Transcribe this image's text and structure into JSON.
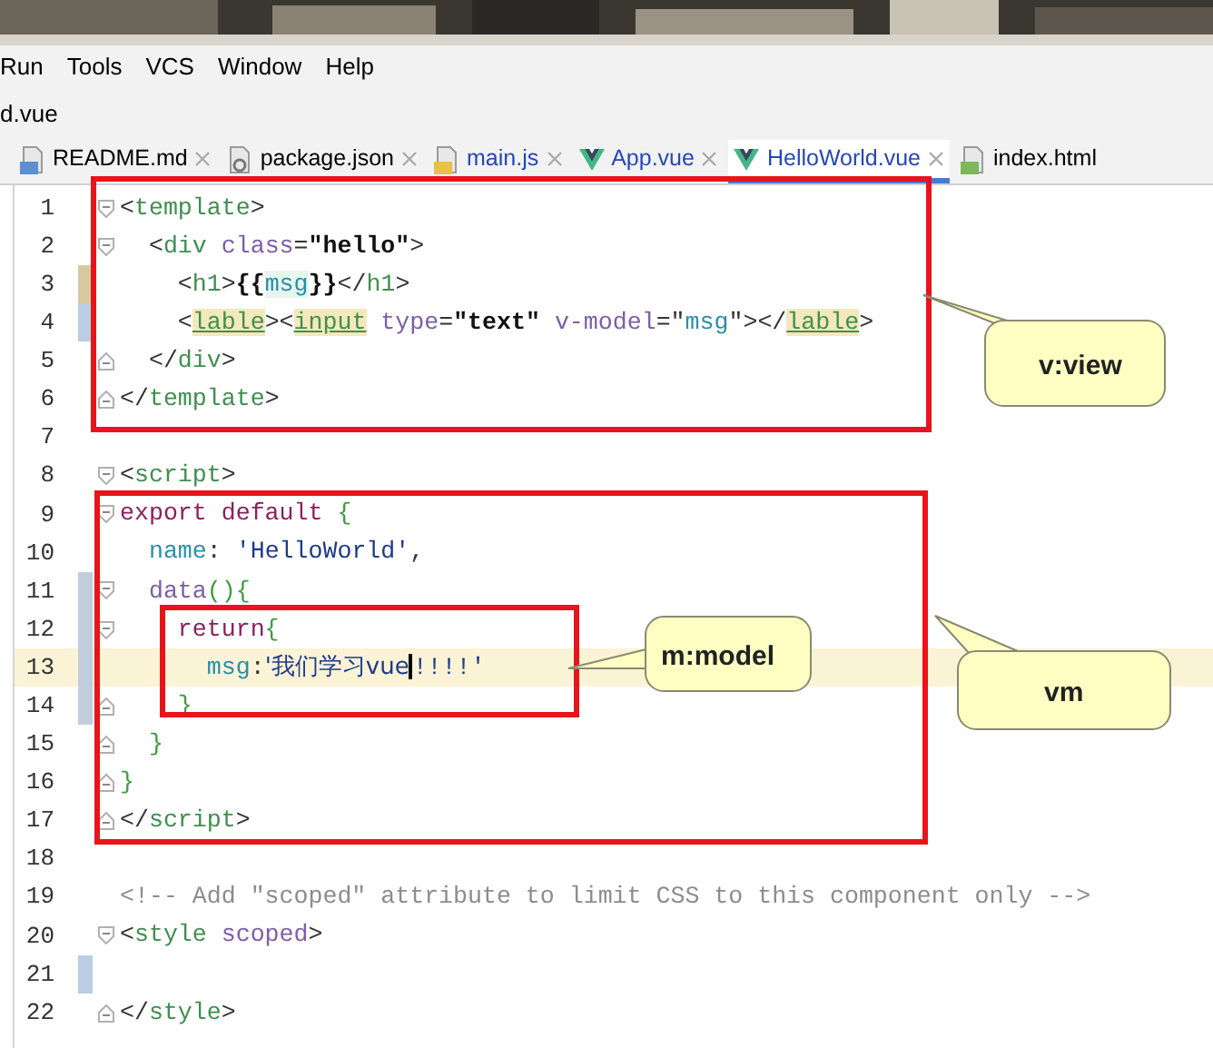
{
  "menu": [
    {
      "label": "Run"
    },
    {
      "label": "Tools"
    },
    {
      "label": "VCS"
    },
    {
      "label": "Window"
    },
    {
      "label": "Help"
    }
  ],
  "breadcrumb": "d.vue",
  "tabs": [
    {
      "label": "README.md",
      "kind": "markdown",
      "modified": false,
      "selected": false
    },
    {
      "label": "package.json",
      "kind": "config",
      "modified": false,
      "selected": false
    },
    {
      "label": "main.js",
      "kind": "script",
      "modified": true,
      "selected": false
    },
    {
      "label": "App.vue",
      "kind": "component",
      "modified": true,
      "selected": false
    },
    {
      "label": "HelloWorld.vue",
      "kind": "component",
      "modified": true,
      "selected": true
    },
    {
      "label": "index.html",
      "kind": "page",
      "modified": false,
      "selected": false
    }
  ],
  "lines": [
    {
      "number": "1",
      "kind": "opener",
      "tokens": [
        {
          "text": "<",
          "kind": "punct"
        },
        {
          "text": "template",
          "kind": "tag"
        },
        {
          "text": ">",
          "kind": "punct"
        }
      ]
    },
    {
      "number": "2",
      "kind": "opener",
      "tokens": [
        {
          "text": "  <",
          "kind": "punct"
        },
        {
          "text": "div",
          "kind": "tag"
        },
        {
          "text": " class",
          "kind": "attr"
        },
        {
          "text": "=",
          "kind": "punct"
        },
        {
          "text": "\"hello\"",
          "kind": "bold"
        },
        {
          "text": ">",
          "kind": "punct"
        }
      ]
    },
    {
      "number": "3",
      "kind": "plain",
      "color": "#d8c9a0",
      "tokens": [
        {
          "text": "    <",
          "kind": "punct"
        },
        {
          "text": "h1",
          "kind": "tag"
        },
        {
          "text": ">",
          "kind": "punct"
        },
        {
          "text": "{{",
          "kind": "bold"
        },
        {
          "text": "msg",
          "kind": "interp"
        },
        {
          "text": "}}",
          "kind": "bold"
        },
        {
          "text": "</",
          "kind": "punct"
        },
        {
          "text": "h1",
          "kind": "tag"
        },
        {
          "text": ">",
          "kind": "punct"
        }
      ]
    },
    {
      "number": "4",
      "kind": "plain",
      "color": "#b9cde3",
      "tokens": [
        {
          "text": "    <",
          "kind": "punct"
        },
        {
          "text": "lable",
          "kind": "marked"
        },
        {
          "text": "><",
          "kind": "punct"
        },
        {
          "text": "input",
          "kind": "marked"
        },
        {
          "text": " type",
          "kind": "attr"
        },
        {
          "text": "=",
          "kind": "punct"
        },
        {
          "text": "\"text\"",
          "kind": "bold"
        },
        {
          "text": " v-model",
          "kind": "attr"
        },
        {
          "text": "=\"",
          "kind": "punct"
        },
        {
          "text": "msg",
          "kind": "prop"
        },
        {
          "text": "\">",
          "kind": "punct"
        },
        {
          "text": "</",
          "kind": "punct"
        },
        {
          "text": "lable",
          "kind": "marked"
        },
        {
          "text": ">",
          "kind": "punct"
        }
      ]
    },
    {
      "number": "5",
      "kind": "closer",
      "tokens": [
        {
          "text": "  </",
          "kind": "punct"
        },
        {
          "text": "div",
          "kind": "tag"
        },
        {
          "text": ">",
          "kind": "punct"
        }
      ]
    },
    {
      "number": "6",
      "kind": "closer",
      "tokens": [
        {
          "text": "</",
          "kind": "punct"
        },
        {
          "text": "template",
          "kind": "tag"
        },
        {
          "text": ">",
          "kind": "punct"
        }
      ]
    },
    {
      "number": "7",
      "kind": "plain"
    },
    {
      "number": "8",
      "kind": "opener",
      "tokens": [
        {
          "text": "<",
          "kind": "punct"
        },
        {
          "text": "script",
          "kind": "tag"
        },
        {
          "text": ">",
          "kind": "punct"
        }
      ]
    },
    {
      "number": "9",
      "kind": "opener",
      "tokens": [
        {
          "text": "export default ",
          "kind": "keyword"
        },
        {
          "text": "{",
          "kind": "brace"
        }
      ]
    },
    {
      "number": "10",
      "kind": "plain",
      "tokens": [
        {
          "text": "  name",
          "kind": "prop"
        },
        {
          "text": ": ",
          "kind": "punct"
        },
        {
          "text": "'HelloWorld'",
          "kind": "string"
        },
        {
          "text": ",",
          "kind": "punct"
        }
      ]
    },
    {
      "number": "11",
      "kind": "opener",
      "color": "#c2cede",
      "tokens": [
        {
          "text": "  data",
          "kind": "fn"
        },
        {
          "text": "(){",
          "kind": "brace"
        }
      ]
    },
    {
      "number": "12",
      "kind": "opener",
      "color": "#c2cede",
      "tokens": [
        {
          "text": "    return",
          "kind": "keyword"
        },
        {
          "text": "{",
          "kind": "brace"
        }
      ]
    },
    {
      "number": "13",
      "kind": "plain",
      "current": true,
      "color": "#c2cede",
      "tokens": [
        {
          "text": "      msg",
          "kind": "prop"
        },
        {
          "text": ":",
          "kind": "punct"
        },
        {
          "text": "'我们学习vue",
          "kind": "string"
        },
        {
          "kind": "caret"
        },
        {
          "text": "!!!!'",
          "kind": "string"
        }
      ]
    },
    {
      "number": "14",
      "kind": "closer",
      "color": "#c2cede",
      "tokens": [
        {
          "text": "    }",
          "kind": "brace"
        }
      ]
    },
    {
      "number": "15",
      "kind": "closer",
      "tokens": [
        {
          "text": "  }",
          "kind": "brace"
        }
      ]
    },
    {
      "number": "16",
      "kind": "closer",
      "tokens": [
        {
          "text": "}",
          "kind": "brace"
        }
      ]
    },
    {
      "number": "17",
      "kind": "closer",
      "tokens": [
        {
          "text": "</",
          "kind": "punct"
        },
        {
          "text": "script",
          "kind": "tag"
        },
        {
          "text": ">",
          "kind": "punct"
        }
      ]
    },
    {
      "number": "18",
      "kind": "plain"
    },
    {
      "number": "19",
      "kind": "plain",
      "tokens": [
        {
          "text": "<!-- Add \"scoped\" attribute to limit CSS to this component only -->",
          "kind": "comment"
        }
      ]
    },
    {
      "number": "20",
      "kind": "opener",
      "tokens": [
        {
          "text": "<",
          "kind": "punct"
        },
        {
          "text": "style",
          "kind": "tag"
        },
        {
          "text": " scoped",
          "kind": "attr"
        },
        {
          "text": ">",
          "kind": "punct"
        }
      ]
    },
    {
      "number": "21",
      "kind": "plain",
      "color": "#b9cde3"
    },
    {
      "number": "22",
      "kind": "closer",
      "tokens": [
        {
          "text": "</",
          "kind": "punct"
        },
        {
          "text": "style",
          "kind": "tag"
        },
        {
          "text": ">",
          "kind": "punct"
        }
      ]
    }
  ],
  "callouts": [
    {
      "label": "v:view"
    },
    {
      "label": "m:model"
    },
    {
      "label": "vm"
    }
  ]
}
